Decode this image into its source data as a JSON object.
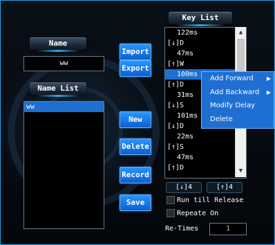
{
  "labels": {
    "name_header": "Name",
    "name_list_header": "Name List",
    "key_list_header": "Key List"
  },
  "name_value": "ww",
  "name_list_items": [
    "ww"
  ],
  "buttons": {
    "import": "Import",
    "export": "Export",
    "new": "New",
    "delete": "Delete",
    "record": "Record",
    "save": "Save"
  },
  "key_list_rows": [
    "122ms",
    "[↓]D",
    "47ms",
    "[↑]W",
    "100ms",
    "[↑]D",
    "31ms",
    "[↓]S",
    "101ms",
    "[↓]D",
    "22ms",
    "[↑]S",
    "47ms",
    "[↑]D"
  ],
  "counters": {
    "down": "[↓]4",
    "up": "[↑]4"
  },
  "options": {
    "run_till_release": "Run till Release",
    "repeate_on": "Repeate On"
  },
  "retimes": {
    "label": "Re-Times",
    "value": "1"
  },
  "context_menu": {
    "add_forward": "Add Forward",
    "add_backward": "Add Backward",
    "modify_delay": "Modify Delay",
    "delete": "Delete"
  },
  "icons": {
    "scroll_up": "chevron-up-icon",
    "scroll_down": "chevron-down-icon",
    "submenu_arrow": "chevron-right-icon"
  },
  "colors": {
    "accent_blue": "#1f6fd3",
    "border_blue": "#1fa6e8"
  }
}
